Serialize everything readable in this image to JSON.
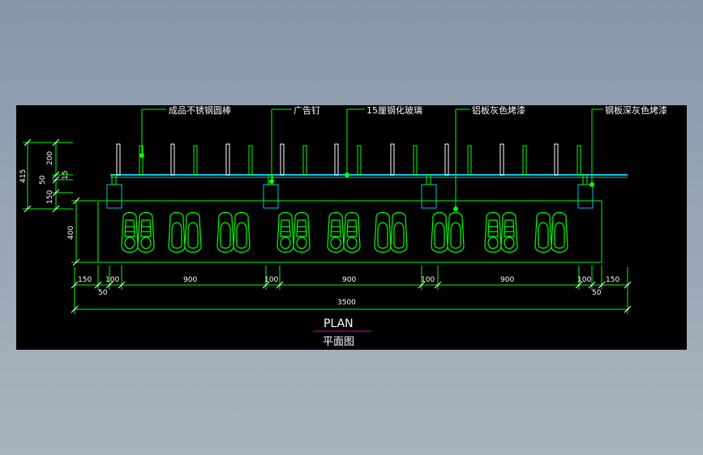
{
  "drawing": {
    "callouts": {
      "rod": "成品不锈钢圆棒",
      "nail": "广告钉",
      "glass": "15厘钢化玻璃",
      "aluminum": "铝板灰色烤漆",
      "steel": "钢板深灰色烤漆"
    },
    "dimensions": {
      "left_vertical": {
        "total": "415",
        "top": "200",
        "a": "50",
        "b": "15",
        "c": "150"
      },
      "box_height": "400",
      "bottom_row": [
        "150",
        "100",
        "900",
        "100",
        "900",
        "100",
        "900",
        "100",
        "150"
      ],
      "under_row": [
        "50",
        "50"
      ],
      "total": "3500"
    },
    "title": "PLAN",
    "subtitle": "平面图",
    "colors": {
      "background": "#000000",
      "line_green": "#00ff00",
      "line_white": "#ffffff",
      "glass_cyan": "#00c8e6",
      "title_underline": "#cc00cc"
    }
  }
}
